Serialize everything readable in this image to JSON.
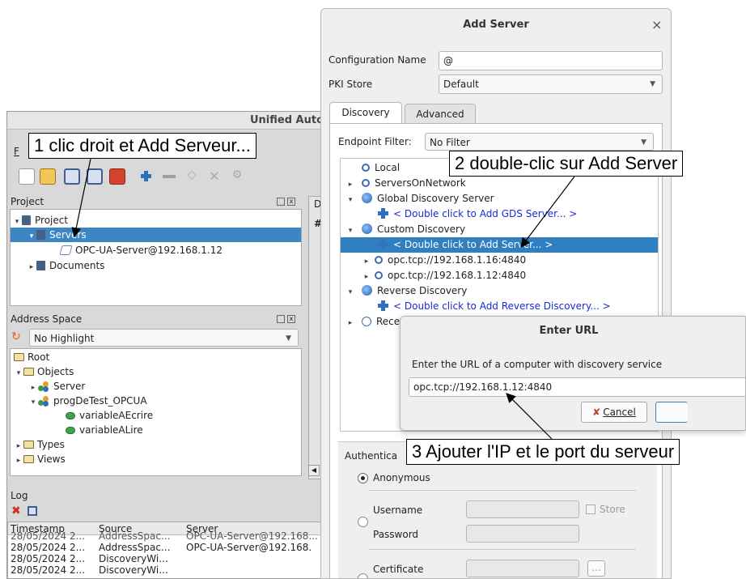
{
  "main_window": {
    "title": "Unified Auto",
    "menu_first": "F",
    "project_panel": {
      "title": "Project",
      "tree": [
        {
          "label": "Project",
          "icon": "book-icon"
        },
        {
          "label": "Servers",
          "icon": "book-icon",
          "selected": true
        },
        {
          "label": "OPC-UA-Server@192.168.1.12",
          "icon": "server-link-icon"
        },
        {
          "label": "Documents",
          "icon": "book-icon"
        }
      ]
    },
    "side_tab": "D",
    "side_tab2": "#",
    "address_space": {
      "title": "Address Space",
      "highlight_value": "No Highlight",
      "tree": [
        {
          "label": "Root"
        },
        {
          "label": "Objects"
        },
        {
          "label": "Server"
        },
        {
          "label": "progDeTest_OPCUA"
        },
        {
          "label": "variableAEcrire"
        },
        {
          "label": "variableALire"
        },
        {
          "label": "Types"
        },
        {
          "label": "Views"
        }
      ]
    },
    "log": {
      "title": "Log",
      "columns": [
        "Timestamp",
        "Source",
        "Server"
      ],
      "rows": [
        [
          "28/05/2024 2...",
          "AddressSpac...",
          "OPC-UA-Server@192.168..."
        ],
        [
          "28/05/2024 2...",
          "AddressSpac...",
          "OPC-UA-Server@192.168."
        ],
        [
          "28/05/2024 2...",
          "DiscoveryWi...",
          ""
        ],
        [
          "28/05/2024 2...",
          "DiscoveryWi...",
          ""
        ]
      ]
    }
  },
  "add_server_dialog": {
    "title": "Add Server",
    "close_glyph": "×",
    "config_name_label": "Configuration Name",
    "config_name_value": "@",
    "pki_store_label": "PKI Store",
    "pki_store_value": "Default",
    "tabs": [
      "Discovery",
      "Advanced"
    ],
    "endpoint_filter_label": "Endpoint Filter:",
    "endpoint_filter_value": "No Filter",
    "discovery_tree": [
      {
        "label": "Local",
        "indent": 1,
        "icon": "search-icon",
        "expander": ""
      },
      {
        "label": "ServersOnNetwork",
        "indent": 1,
        "icon": "search-icon",
        "expander": "▸"
      },
      {
        "label": "Global Discovery Server",
        "indent": 1,
        "icon": "globe-icon",
        "expander": "▾"
      },
      {
        "label": "< Double click to Add GDS Server... >",
        "indent": 2,
        "icon": "plus-icon",
        "expander": "",
        "link": true
      },
      {
        "label": "Custom Discovery",
        "indent": 1,
        "icon": "globe-icon",
        "expander": "▾"
      },
      {
        "label": "< Double click to Add Server... >",
        "indent": 2,
        "icon": "plus-icon",
        "expander": "",
        "selected": true
      },
      {
        "label": "opc.tcp://192.168.1.16:4840",
        "indent": 2,
        "icon": "search-icon",
        "expander": "▸"
      },
      {
        "label": "opc.tcp://192.168.1.12:4840",
        "indent": 2,
        "icon": "search-icon",
        "expander": "▸"
      },
      {
        "label": "Reverse Discovery",
        "indent": 1,
        "icon": "globe-icon",
        "expander": "▾"
      },
      {
        "label": "< Double click to Add Reverse Discovery... >",
        "indent": 2,
        "icon": "plus-icon",
        "expander": "",
        "link": true
      },
      {
        "label": "Rece",
        "indent": 1,
        "icon": "clock-icon",
        "expander": "▸"
      }
    ],
    "authentication_label": "Authentica",
    "anonymous_label": "Anonymous",
    "username_label": "Username",
    "password_label": "Password",
    "store_label": "Store",
    "certificate_label": "Certificate",
    "browse_label": "..."
  },
  "enter_url_dialog": {
    "title": "Enter URL",
    "prompt": "Enter the URL of a computer with discovery service",
    "url_value": "opc.tcp://192.168.1.12:4840",
    "cancel_label": "Cancel"
  },
  "callouts": {
    "step1": "1 clic droit et Add Serveur...",
    "step2": "2 double-clic sur Add Server",
    "step3": "3 Ajouter l'IP et le port du serveur"
  }
}
